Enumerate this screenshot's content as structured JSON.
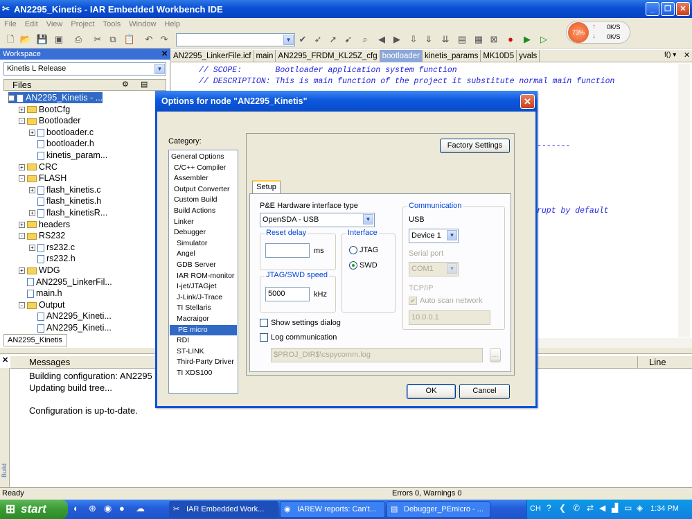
{
  "window": {
    "title": "AN2295_Kinetis - IAR Embedded Workbench IDE"
  },
  "menu": [
    "File",
    "Edit",
    "View",
    "Project",
    "Tools",
    "Window",
    "Help"
  ],
  "network": {
    "cpu": "73%",
    "up": "0K/S",
    "down": "0K/S"
  },
  "workspace": {
    "title": "Workspace",
    "config": "Kinetis L Release",
    "files_header": "Files",
    "tab": "AN2295_Kinetis",
    "tree": [
      {
        "label": "AN2295_Kinetis - ...",
        "box": "-",
        "kind": "proj",
        "level": 0,
        "selected": true
      },
      {
        "label": "BootCfg",
        "box": "+",
        "kind": "folder",
        "level": 1
      },
      {
        "label": "Bootloader",
        "box": "-",
        "kind": "folder",
        "level": 1
      },
      {
        "label": "bootloader.c",
        "box": "+",
        "kind": "file",
        "level": 2
      },
      {
        "label": "bootloader.h",
        "box": "",
        "kind": "file",
        "level": 2
      },
      {
        "label": "kinetis_param...",
        "box": "",
        "kind": "file",
        "level": 2
      },
      {
        "label": "CRC",
        "box": "+",
        "kind": "folder",
        "level": 1
      },
      {
        "label": "FLASH",
        "box": "-",
        "kind": "folder",
        "level": 1
      },
      {
        "label": "flash_kinetis.c",
        "box": "+",
        "kind": "file",
        "level": 2
      },
      {
        "label": "flash_kinetis.h",
        "box": "",
        "kind": "file",
        "level": 2
      },
      {
        "label": "flash_kinetisR...",
        "box": "+",
        "kind": "file",
        "level": 2
      },
      {
        "label": "headers",
        "box": "+",
        "kind": "folder",
        "level": 1
      },
      {
        "label": "RS232",
        "box": "-",
        "kind": "folder",
        "level": 1
      },
      {
        "label": "rs232.c",
        "box": "+",
        "kind": "file",
        "level": 2
      },
      {
        "label": "rs232.h",
        "box": "",
        "kind": "file",
        "level": 2
      },
      {
        "label": "WDG",
        "box": "+",
        "kind": "folder",
        "level": 1
      },
      {
        "label": "AN2295_LinkerFil...",
        "box": "",
        "kind": "file",
        "level": 1
      },
      {
        "label": "main.h",
        "box": "",
        "kind": "file",
        "level": 1
      },
      {
        "label": "Output",
        "box": "-",
        "kind": "folder",
        "level": 1
      },
      {
        "label": "AN2295_Kineti...",
        "box": "",
        "kind": "file",
        "level": 2
      },
      {
        "label": "AN2295_Kineti...",
        "box": "",
        "kind": "file",
        "level": 2
      }
    ]
  },
  "editor": {
    "tabs": [
      "AN2295_LinkerFile.icf",
      "main",
      "AN2295_FRDM_KL25Z_cfg",
      "bootloader",
      "kinetis_params",
      "MK10D5",
      "yvals"
    ],
    "active_tab": "bootloader",
    "tab_menu": "f() ▾",
    "code": {
      "scope": "// SCOPE:       Bootloader application system function",
      "desc": "// DESCRIPTION: This is main function of the project it substitute normal main function",
      "dashes": "-------",
      "rupt": "rupt by default"
    }
  },
  "messages": {
    "header": "Messages",
    "line_header": "Line",
    "lines": [
      "Building configuration: AN2295",
      "Updating build tree...",
      "",
      "Configuration is up-to-date."
    ],
    "side_label": "Build"
  },
  "status": {
    "left": "Ready",
    "center": "Errors 0, Warnings 0"
  },
  "dialog": {
    "title": "Options for node \"AN2295_Kinetis\"",
    "category_label": "Category:",
    "categories": [
      {
        "label": "General Options",
        "indent": 0
      },
      {
        "label": "C/C++ Compiler",
        "indent": 1
      },
      {
        "label": "Assembler",
        "indent": 1
      },
      {
        "label": "Output Converter",
        "indent": 1
      },
      {
        "label": "Custom Build",
        "indent": 1
      },
      {
        "label": "Build Actions",
        "indent": 1
      },
      {
        "label": "Linker",
        "indent": 1
      },
      {
        "label": "Debugger",
        "indent": 1
      },
      {
        "label": "Simulator",
        "indent": 2
      },
      {
        "label": "Angel",
        "indent": 2
      },
      {
        "label": "GDB Server",
        "indent": 2
      },
      {
        "label": "IAR ROM-monitor",
        "indent": 2
      },
      {
        "label": "I-jet/JTAGjet",
        "indent": 2
      },
      {
        "label": "J-Link/J-Trace",
        "indent": 2
      },
      {
        "label": "TI Stellaris",
        "indent": 2
      },
      {
        "label": "Macraigor",
        "indent": 2
      },
      {
        "label": "PE micro",
        "indent": 2,
        "selected": true
      },
      {
        "label": "RDI",
        "indent": 2
      },
      {
        "label": "ST-LINK",
        "indent": 2
      },
      {
        "label": "Third-Party Driver",
        "indent": 2
      },
      {
        "label": "TI XDS100",
        "indent": 2
      }
    ],
    "factory_settings": "Factory Settings",
    "tab": "Setup",
    "hw_interface_label": "P&E Hardware interface type",
    "hw_interface_value": "OpenSDA - USB",
    "reset_delay": {
      "title": "Reset delay",
      "value": "",
      "unit": "ms"
    },
    "speed": {
      "title": "JTAG/SWD speed",
      "value": "5000",
      "unit": "kHz"
    },
    "interface": {
      "title": "Interface",
      "options": [
        "JTAG",
        "SWD"
      ],
      "selected": "SWD"
    },
    "communication": {
      "title": "Communication",
      "usb_label": "USB",
      "device": "Device 1",
      "serial_label": "Serial port",
      "serial_value": "COM1",
      "tcp_label": "TCP/IP",
      "auto_scan": "Auto scan network",
      "ip": "10.0.0.1"
    },
    "show_settings": "Show settings dialog",
    "log_comm": "Log communication",
    "log_path": "$PROJ_DIR$\\cspycomm.log",
    "browse": "...",
    "ok": "OK",
    "cancel": "Cancel"
  },
  "taskbar": {
    "start": "start",
    "tasks": [
      "IAR Embedded Work...",
      "IAREW reports: Can't...",
      "Debugger_PEmicro - ..."
    ],
    "lang": "CH",
    "time": "1:34 PM"
  }
}
